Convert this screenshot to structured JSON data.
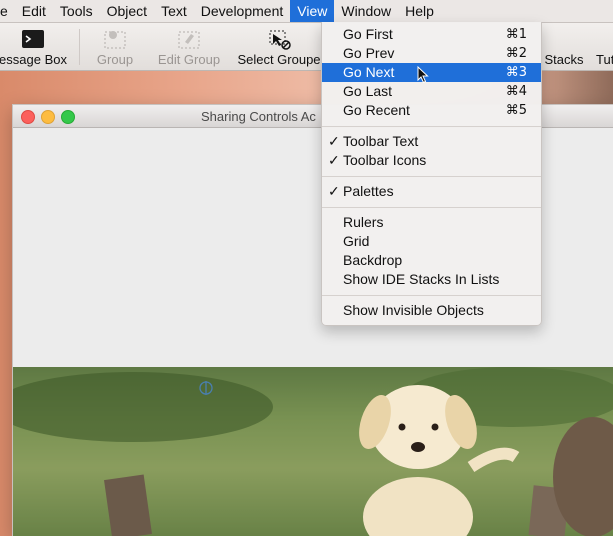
{
  "menubar": {
    "items": [
      "e",
      "Edit",
      "Tools",
      "Object",
      "Text",
      "Development",
      "View",
      "Window",
      "Help"
    ],
    "active_index": 6
  },
  "toolbar": {
    "message_box": "essage Box",
    "group": "Group",
    "edit_group": "Edit Group",
    "select_grouped": "Select Groupe",
    "stacks": "Stacks",
    "tutorials": "Tut"
  },
  "window": {
    "title": "Sharing Controls Ac"
  },
  "view_menu": {
    "items": [
      {
        "label": "Go First",
        "shortcut": "⌘1",
        "checked": false,
        "highlighted": false
      },
      {
        "label": "Go Prev",
        "shortcut": "⌘2",
        "checked": false,
        "highlighted": false
      },
      {
        "label": "Go Next",
        "shortcut": "⌘3",
        "checked": false,
        "highlighted": true
      },
      {
        "label": "Go Last",
        "shortcut": "⌘4",
        "checked": false,
        "highlighted": false
      },
      {
        "label": "Go Recent",
        "shortcut": "⌘5",
        "checked": false,
        "highlighted": false
      },
      {
        "label": "Toolbar Text",
        "shortcut": "",
        "checked": true,
        "highlighted": false
      },
      {
        "label": "Toolbar Icons",
        "shortcut": "",
        "checked": true,
        "highlighted": false
      },
      {
        "label": "Palettes",
        "shortcut": "",
        "checked": true,
        "highlighted": false
      },
      {
        "label": "Rulers",
        "shortcut": "",
        "checked": false,
        "highlighted": false
      },
      {
        "label": "Grid",
        "shortcut": "",
        "checked": false,
        "highlighted": false
      },
      {
        "label": "Backdrop",
        "shortcut": "",
        "checked": false,
        "highlighted": false
      },
      {
        "label": "Show IDE Stacks In Lists",
        "shortcut": "",
        "checked": false,
        "highlighted": false
      },
      {
        "label": "Show Invisible Objects",
        "shortcut": "",
        "checked": false,
        "highlighted": false
      }
    ]
  },
  "colors": {
    "highlight": "#1f6fd9",
    "close": "#fc605c",
    "minimize": "#fdbc40",
    "zoom": "#34c84a"
  }
}
